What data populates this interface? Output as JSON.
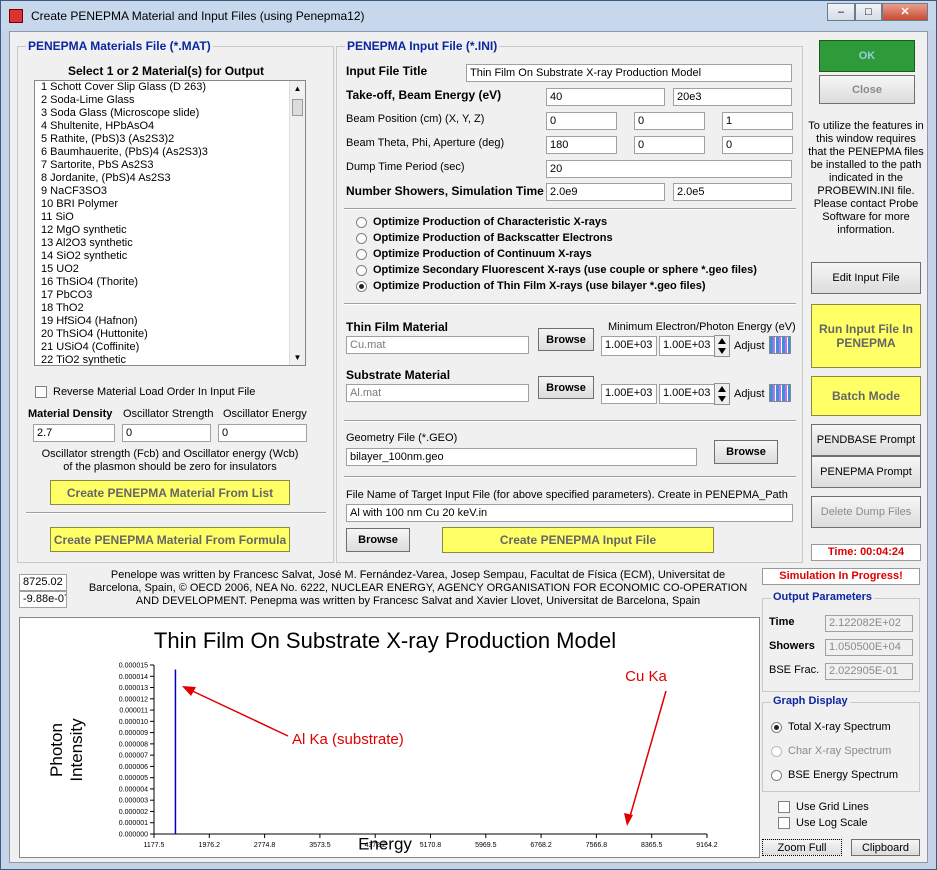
{
  "window": {
    "title": "Create PENEPMA Material and Input Files (using Penepma12)"
  },
  "materials": {
    "group_title": "PENEPMA Materials File (*.MAT)",
    "select_label": "Select 1 or 2 Material(s) for Output",
    "items": [
      "1 Schott Cover Slip Glass (D 263)",
      "2 Soda-Lime Glass",
      "3 Soda Glass (Microscope slide)",
      "4 Shultenite, HPbAsO4",
      "5 Rathite, (PbS)3 (As2S3)2",
      "6 Baumhauerite, (PbS)4 (As2S3)3",
      "7 Sartorite, PbS As2S3",
      "8 Jordanite, (PbS)4 As2S3",
      "9 NaCF3SO3",
      "10 BRI Polymer",
      "11 SiO",
      "12 MgO synthetic",
      "13 Al2O3 synthetic",
      "14 SiO2 synthetic",
      "15 UO2",
      "16 ThSiO4 (Thorite)",
      "17 PbCO3",
      "18 ThO2",
      "19 HfSiO4 (Hafnon)",
      "20 ThSiO4 (Huttonite)",
      "21 USiO4 (Coffinite)",
      "22 TiO2 synthetic"
    ],
    "reverse_label": "Reverse Material Load Order In Input File",
    "density_label": "Material Density",
    "osc_strength_label": "Oscillator Strength",
    "osc_energy_label": "Oscillator Energy",
    "density": "2.7",
    "osc_strength": "0",
    "osc_energy": "0",
    "note": "Oscillator strength (Fcb) and Oscillator energy (Wcb) of the plasmon should be zero for insulators",
    "from_list_btn": "Create PENEPMA Material From List",
    "from_formula_btn": "Create PENEPMA Material From Formula"
  },
  "input": {
    "group_title": "PENEPMA Input File (*.INI)",
    "title_label": "Input File Title",
    "title_value": "Thin Film On Substrate X-ray Production Model",
    "takeoff_label": "Take-off, Beam Energy (eV)",
    "takeoff": "40",
    "beam_energy": "20e3",
    "beampos_label": "Beam Position (cm) (X, Y, Z)",
    "bx": "0",
    "by": "0",
    "bz": "1",
    "theta_label": "Beam Theta, Phi, Aperture (deg)",
    "theta": "180",
    "phi": "0",
    "aperture": "0",
    "dump_label": "Dump Time Period (sec)",
    "dump": "20",
    "showers_label": "Number Showers, Simulation Time",
    "showers": "2.0e9",
    "simtime": "2.0e5",
    "options": [
      "Optimize Production of Characteristic X-rays",
      "Optimize Production of Backscatter Electrons",
      "Optimize Production of Continuum X-rays",
      "Optimize Secondary Fluorescent X-rays (use couple or sphere *.geo files)",
      "Optimize Production of Thin Film X-rays (use bilayer *.geo files)"
    ],
    "thin_label": "Thin Film Material",
    "thin_value": "Cu.mat",
    "browse": "Browse",
    "minenergy_label": "Minimum Electron/Photon Energy (eV)",
    "e1": "1.00E+03",
    "e2": "1.00E+03",
    "adjust": "Adjust",
    "sub_label": "Substrate Material",
    "sub_value": "Al.mat",
    "e3": "1.00E+03",
    "e4": "1.00E+03",
    "geo_label": "Geometry File (*.GEO)",
    "geo_value": "bilayer_100nm.geo",
    "target_label": "File Name of Target Input File (for above specified parameters). Create in PENEPMA_Path",
    "target_value": "Al with 100 nm Cu 20 keV.in",
    "create_btn": "Create PENEPMA Input File"
  },
  "right": {
    "ok": "OK",
    "close": "Close",
    "info": "To utilize the features in this window requires that the PENEPMA files be installed to the path indicated in the PROBEWIN.INI file. Please contact Probe Software for more information.",
    "edit": "Edit Input File",
    "run": "Run Input File In PENEPMA",
    "batch": "Batch Mode",
    "pendbase": "PENDBASE Prompt",
    "penepma": "PENEPMA Prompt",
    "delete": "Delete Dump Files",
    "time": "Time: 00:04:24",
    "progress": "Simulation In Progress!"
  },
  "cursor": {
    "x": "8725.02",
    "y": "-9.88e-07"
  },
  "credits": "Penelope was written by Francesc Salvat, José M. Fernández-Varea, Josep Sempau, Facultat de Física (ECM), Universitat de Barcelona, Spain, © OECD 2006, NEA No. 6222, NUCLEAR ENERGY, AGENCY ORGANISATION FOR ECONOMIC CO-OPERATION AND DEVELOPMENT. Penepma was written by Francesc Salvat and Xavier Llovet, Universitat de Barcelona, Spain",
  "output": {
    "title": "Output Parameters",
    "time_label": "Time",
    "time": "2.122082E+02",
    "showers_label": "Showers",
    "showers": "1.050500E+04",
    "bse_label": "BSE Frac.",
    "bse": "2.022905E-01"
  },
  "graph": {
    "title": "Graph Display",
    "options": [
      "Total X-ray Spectrum",
      "Char X-ray Spectrum",
      "BSE Energy Spectrum"
    ],
    "grid": "Use Grid Lines",
    "log": "Use Log Scale",
    "zoom": "Zoom Full",
    "clipboard": "Clipboard"
  },
  "chart_data": {
    "type": "line",
    "title": "Thin Film On Substrate X-ray Production Model",
    "xlabel": "Energy",
    "ylabel": "Photon Intensity",
    "xticks": [
      "1177.5",
      "1976.2",
      "2774.8",
      "3573.5",
      "4372.2",
      "5170.8",
      "5969.5",
      "6768.2",
      "7566.8",
      "8365.5",
      "9164.2"
    ],
    "yticks": [
      "0.000000",
      "0.000001",
      "0.000002",
      "0.000003",
      "0.000004",
      "0.000005",
      "0.000006",
      "0.000007",
      "0.000008",
      "0.000009",
      "0.000010",
      "0.000011",
      "0.000012",
      "0.000013",
      "0.000014",
      "0.000015"
    ],
    "xlim": [
      1177.5,
      9164.2
    ],
    "ylim": [
      0,
      1.5e-05
    ],
    "peak": {
      "x": 1487,
      "y": 1.46e-05,
      "color": "#0000cc"
    },
    "annotations": [
      {
        "text": "Al Ka  (substrate)",
        "color": "#e00000"
      },
      {
        "text": "Cu Ka",
        "color": "#e00000"
      }
    ]
  }
}
